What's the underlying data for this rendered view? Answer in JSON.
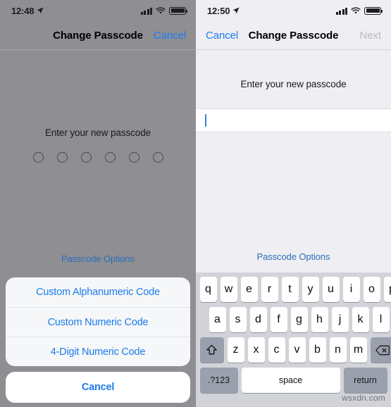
{
  "left_screen": {
    "status_bar": {
      "time": "12:48",
      "location_icon": "location-arrow-icon",
      "signal_icon": "cellular-signal-icon",
      "wifi_icon": "wifi-icon",
      "battery_icon": "battery-icon"
    },
    "nav_bar": {
      "title": "Change Passcode",
      "right_button": "Cancel"
    },
    "prompt": "Enter your new passcode",
    "passcode_dots": 6,
    "passcode_options_link": "Passcode Options",
    "action_sheet": {
      "options": [
        "Custom Alphanumeric Code",
        "Custom Numeric Code",
        "4-Digit Numeric Code"
      ],
      "cancel": "Cancel"
    }
  },
  "right_screen": {
    "status_bar": {
      "time": "12:50",
      "location_icon": "location-arrow-icon",
      "signal_icon": "cellular-signal-icon",
      "wifi_icon": "wifi-icon",
      "battery_icon": "battery-icon"
    },
    "nav_bar": {
      "left_button": "Cancel",
      "title": "Change Passcode",
      "right_button": "Next"
    },
    "prompt": "Enter your new passcode",
    "passcode_field_value": "",
    "passcode_options_link": "Passcode Options",
    "keyboard": {
      "row1": [
        "q",
        "w",
        "e",
        "r",
        "t",
        "y",
        "u",
        "i",
        "o",
        "p"
      ],
      "row2": [
        "a",
        "s",
        "d",
        "f",
        "g",
        "h",
        "j",
        "k",
        "l"
      ],
      "row3_letters": [
        "z",
        "x",
        "c",
        "v",
        "b",
        "n",
        "m"
      ],
      "shift_key": "shift-icon",
      "backspace_key": "backspace-icon",
      "numbers_key": ".?123",
      "space_key": "space",
      "return_key": "return"
    }
  },
  "watermark": "wsxdn.com",
  "colors": {
    "accent_blue": "#1b7ced",
    "link_blue": "#2a6ebb",
    "scrim_gray": "#8e8e93",
    "page_gray": "#efeef2",
    "keyboard_gray": "#d1d3d9",
    "key_white": "#ffffff",
    "key_dark": "#9ba0ae",
    "disabled_gray": "#b9b9bf",
    "caret_blue": "#3b7ce0"
  }
}
